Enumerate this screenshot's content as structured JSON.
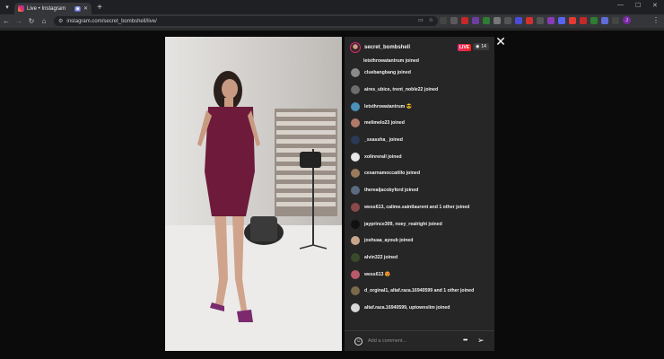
{
  "browser": {
    "tab_title": "Live • Instagram",
    "tab_cast": "▣",
    "url": "instagram.com/secret_bombshell/live/",
    "extension_colors": [
      "#444",
      "#5a5a5a",
      "#c62828",
      "#6b3fa0",
      "#2e7d32",
      "#777",
      "#555",
      "#4b4bd6",
      "#d32f2f",
      "#555",
      "#8a3ab9",
      "#5865f2",
      "#e53935",
      "#c62828",
      "#2e7d32",
      "#5f6dd9",
      "#444"
    ]
  },
  "live": {
    "host": "secret_bombshell",
    "badge": "LIVE",
    "viewer_count": "14",
    "comment_placeholder": "Add a comment..."
  },
  "comments": [
    {
      "text": "letsthrowatantrum joined",
      "color": "#5b6f8a"
    },
    {
      "text": "cluebangbang joined",
      "color": "#8a8a8a"
    },
    {
      "text": "aires_ubice, trent_noble22 joined",
      "color": "#6d6d6d"
    },
    {
      "text": "letsthrowatantrum 😎",
      "color": "#4a90b8"
    },
    {
      "text": "melimelo23 joined",
      "color": "#b07a6a"
    },
    {
      "text": "_ssassha_ joined",
      "color": "#2b3a55"
    },
    {
      "text": "xolinrerall joined",
      "color": "#e8e8e8"
    },
    {
      "text": "cesarnamoccatillo joined",
      "color": "#9a7a5a"
    },
    {
      "text": "therealjacobyford joined",
      "color": "#5a6a80"
    },
    {
      "text": "wess613, calime.saintlaurent and 1 other joined",
      "color": "#8a4a4a"
    },
    {
      "text": "jayprince309, noey_realright joined",
      "color": "#111"
    },
    {
      "text": "joshuaa_ayoub joined",
      "color": "#c9a68a"
    },
    {
      "text": "alvin322 joined",
      "color": "#3a4a2a"
    },
    {
      "text": "wess613 😍",
      "color": "#b85a6a"
    },
    {
      "text": "d_orginal1, altaf.raza.16940599 and 1 other joined",
      "color": "#7a6a4a"
    },
    {
      "text": "altaf.raza.16940599, uptownslim joined",
      "color": "#d8d8d8"
    }
  ]
}
